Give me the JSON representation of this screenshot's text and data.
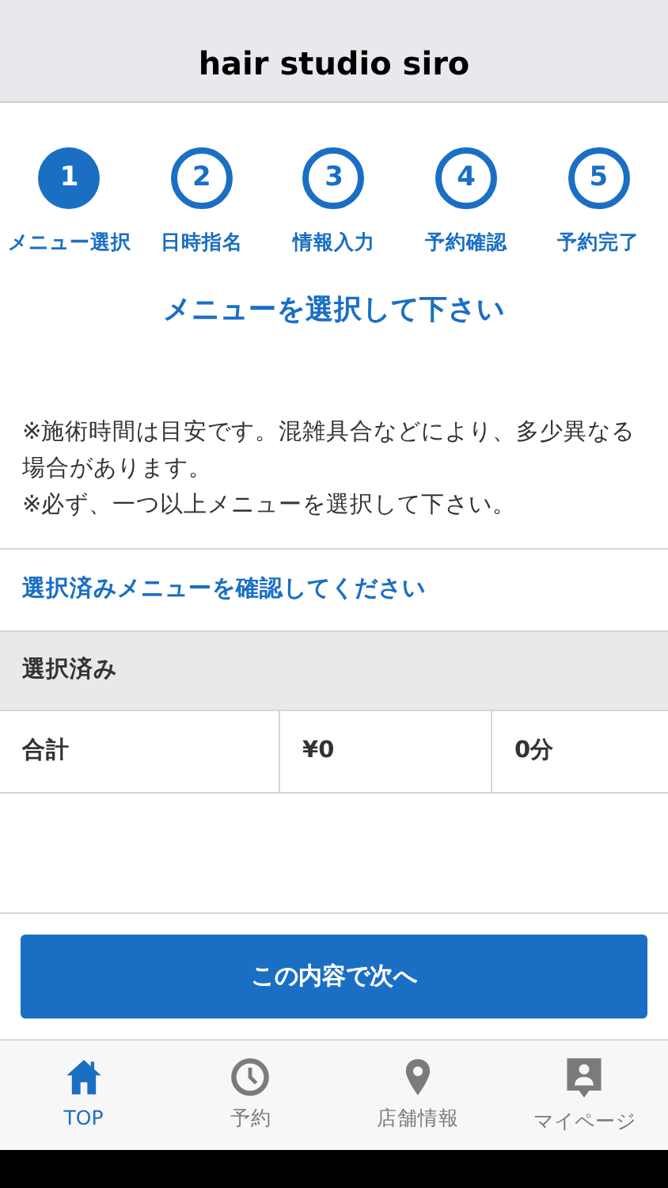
{
  "header": {
    "title": "hair studio siro"
  },
  "steps": [
    {
      "number": "1",
      "label": "メニュー選択",
      "selected": true
    },
    {
      "number": "2",
      "label": "日時指名",
      "selected": false
    },
    {
      "number": "3",
      "label": "情報入力",
      "selected": false
    },
    {
      "number": "4",
      "label": "予約確認",
      "selected": false
    },
    {
      "number": "5",
      "label": "予約完了",
      "selected": false
    }
  ],
  "heading": "メニューを選択して下さい",
  "notes": [
    "※施術時間は目安です。混雑具合などにより、多少異なる場合があります。",
    "※必ず、一つ以上メニューを選択して下さい。"
  ],
  "confirm_link": "選択済みメニューを確認してください",
  "selected_section": {
    "title": "選択済み",
    "total_row": [
      "合計",
      "¥0",
      "0分"
    ]
  },
  "next_button": "この内容で次へ",
  "tab_bar": [
    {
      "kind": "home",
      "label": "TOP",
      "selected": true
    },
    {
      "kind": "clock",
      "label": "予約",
      "selected": false
    },
    {
      "kind": "pin",
      "label": "店舗情報",
      "selected": false
    },
    {
      "kind": "person",
      "label": "マイページ",
      "selected": false
    }
  ]
}
